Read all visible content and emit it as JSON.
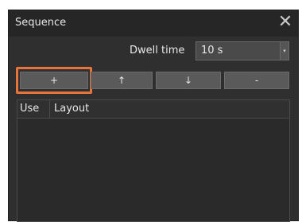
{
  "window": {
    "title": "Sequence",
    "close_glyph": "✕"
  },
  "dwell": {
    "label": "Dwell time",
    "value": "10 s",
    "arrow_glyph": "▾"
  },
  "toolbar": {
    "add_label": "+",
    "up_label": "↑",
    "down_label": "↓",
    "remove_label": "-"
  },
  "table": {
    "columns": [
      "Use",
      "Layout"
    ],
    "rows": []
  },
  "colors": {
    "highlight": "#e8743b",
    "window_bg": "#2f2f2f"
  }
}
